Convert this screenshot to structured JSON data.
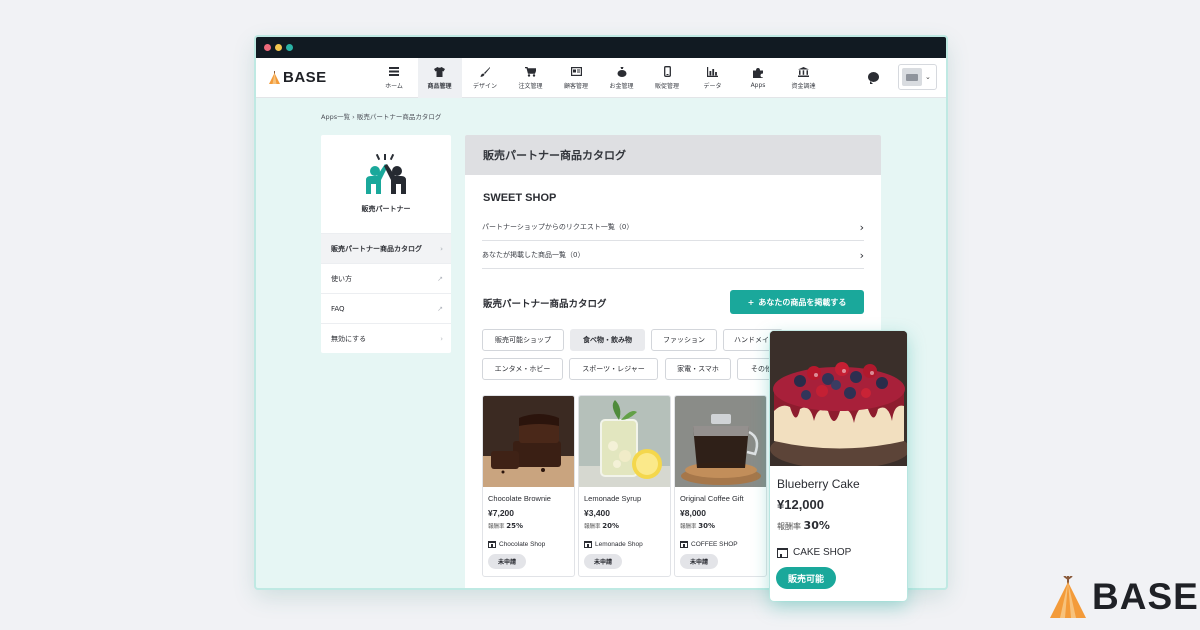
{
  "window": {
    "controls": [
      "close",
      "minimize",
      "maximize"
    ]
  },
  "brand": {
    "name": "BASE",
    "colors": {
      "accent": "#1aa89b",
      "logo_orange": "#f39b3a",
      "logo_brown": "#8a5a3b"
    }
  },
  "topnav": {
    "items": [
      {
        "label": "ホーム",
        "icon": "list-icon"
      },
      {
        "label": "商品管理",
        "icon": "tshirt-icon",
        "active": true
      },
      {
        "label": "デザイン",
        "icon": "brush-icon"
      },
      {
        "label": "注文管理",
        "icon": "cart-icon"
      },
      {
        "label": "顧客管理",
        "icon": "id-card-icon"
      },
      {
        "label": "お金管理",
        "icon": "money-bag-icon"
      },
      {
        "label": "販促管理",
        "icon": "phone-icon"
      },
      {
        "label": "データ",
        "icon": "bar-chart-icon"
      },
      {
        "label": "Apps",
        "icon": "puzzle-icon"
      },
      {
        "label": "資金調達",
        "icon": "bank-icon"
      }
    ]
  },
  "breadcrumb": {
    "parent": "Apps一覧",
    "separator": "›",
    "current": "販売パートナー商品カタログ"
  },
  "sidebar": {
    "app_name": "販売パートナー",
    "items": [
      {
        "label": "販売パートナー商品カタログ",
        "tail": "›",
        "active": true
      },
      {
        "label": "使い方",
        "tail": "↗"
      },
      {
        "label": "FAQ",
        "tail": "↗"
      },
      {
        "label": "無効にする",
        "tail": "›"
      }
    ]
  },
  "main": {
    "header": "販売パートナー商品カタログ",
    "shop_name": "SWEET SHOP",
    "links": [
      {
        "label": "パートナーショップからのリクエスト一覧（0）"
      },
      {
        "label": "あなたが掲載した商品一覧（0）"
      }
    ],
    "catalog_title": "販売パートナー商品カタログ",
    "post_button": "あなたの商品を掲載する",
    "categories_row1": [
      "販売可能ショップ",
      "食べ物・飲み物",
      "ファッション",
      "ハンドメイド"
    ],
    "categories_row2": [
      "エンタメ・ホビー",
      "スポーツ・レジャー",
      "家電・スマホ",
      "その他"
    ],
    "active_category": "食べ物・飲み物",
    "reward_label": "報酬率",
    "products": [
      {
        "name": "Chocolate Brownie",
        "price": "¥7,200",
        "reward": "25%",
        "shop": "Chocolate Shop",
        "status": "未申請"
      },
      {
        "name": "Lemonade Syrup",
        "price": "¥3,400",
        "reward": "20%",
        "shop": "Lemonade Shop",
        "status": "未申請"
      },
      {
        "name": "Original Coffee Gift",
        "price": "¥8,000",
        "reward": "30%",
        "shop": "COFFEE SHOP",
        "status": "未申請"
      }
    ]
  },
  "featured": {
    "name": "Blueberry Cake",
    "price": "¥12,000",
    "reward_label": "報酬率",
    "reward": "30%",
    "shop": "CAKE SHOP",
    "status": "販売可能"
  }
}
